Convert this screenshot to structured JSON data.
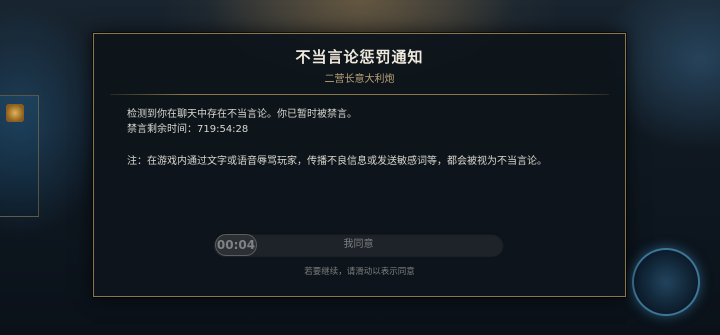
{
  "dialog": {
    "title": "不当言论惩罚通知",
    "subtitle": "二营长意大利炮",
    "message_line1": "检测到你在聊天中存在不当言论。你已暂时被禁言。",
    "message_line2": "禁言剩余时间：719:54:28",
    "note": "注：在游戏内通过文字或语音辱骂玩家，传播不良信息或发送敏感词等，都会被视为不当言论。"
  },
  "slider": {
    "countdown": "00:04",
    "label": "我同意",
    "hint": "若要继续，请滑动以表示同意"
  }
}
